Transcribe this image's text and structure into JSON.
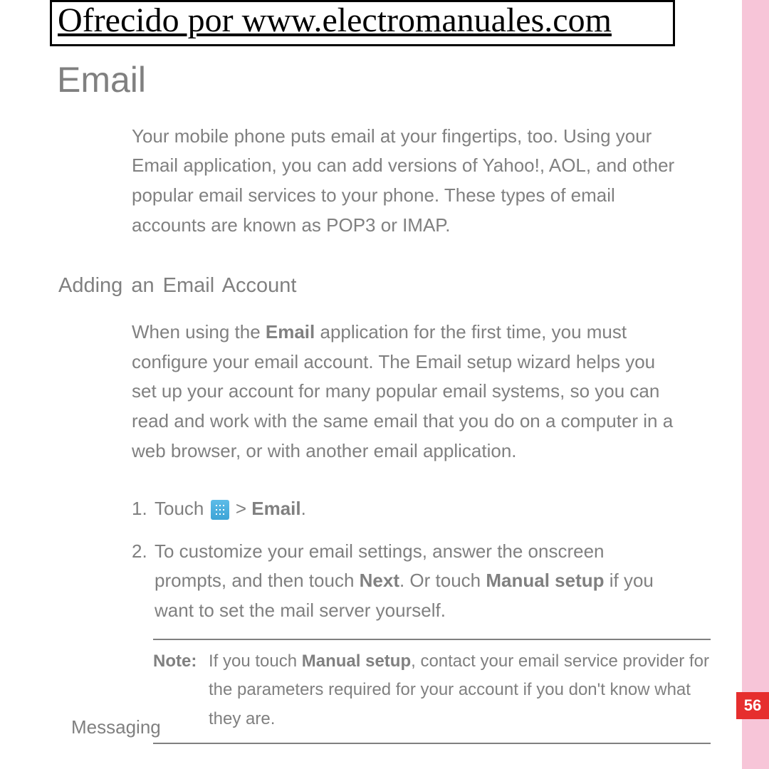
{
  "header": {
    "watermark": "Ofrecido por www.electromanuales.com"
  },
  "section": {
    "title": "Email",
    "intro": "Your mobile phone puts email at your fingertips, too. Using your Email application, you can add versions of Yahoo!, AOL, and other popular email services to your phone. These types of email accounts are known as POP3 or IMAP."
  },
  "subsection": {
    "heading": "Adding an Email Account",
    "body_pre": "When using the ",
    "body_bold1": "Email",
    "body_post": " application for the first time, you must configure your email account. The Email setup wizard helps you set up your account for many popular email systems, so you can read and work with the same email that you do on a computer in a web browser, or with another email application."
  },
  "steps": {
    "s1": {
      "num": "1.",
      "t1": "Touch ",
      "t2": " > ",
      "bold": "Email",
      "t3": "."
    },
    "s2": {
      "num": "2.",
      "t1": "To customize your email settings, answer the onscreen prompts, and then touch ",
      "b1": "Next",
      "t2": ". Or touch ",
      "b2": "Manual setup",
      "t3": " if you want to set the mail server yourself."
    }
  },
  "note": {
    "label": "Note:",
    "t1": "If you touch ",
    "b1": "Manual setup",
    "t2": ", contact your email service provider for the parameters required for your account if you don't know what they are."
  },
  "footer": {
    "chapter": "Messaging",
    "page": "56"
  }
}
